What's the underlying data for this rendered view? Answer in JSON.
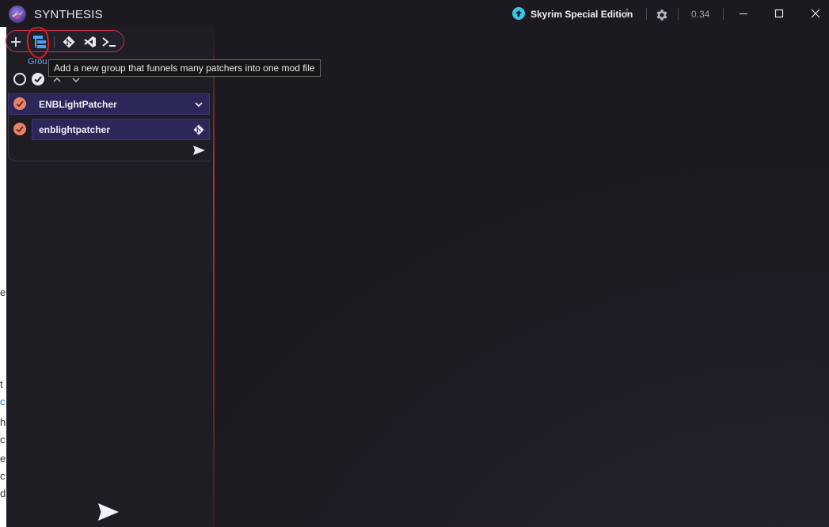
{
  "app": {
    "title": "SYNTHESIS"
  },
  "header": {
    "game_label": "Skyrim Special Edition",
    "version": "0.34",
    "icons": [
      "synthesis-logo-icon",
      "game-upload-icon",
      "info-icon",
      "gear-icon",
      "minimize-icon",
      "maximize-icon",
      "close-icon"
    ]
  },
  "toolbar": {
    "buttons": [
      "add-icon",
      "add-group-icon",
      "git-icon",
      "visual-studio-icon",
      "terminal-icon"
    ],
    "group_hint": "Grou",
    "tooltip": "Add a new group that funnels many patchers into one mod file"
  },
  "group": {
    "name": "ENBLightPatcher",
    "patchers": [
      {
        "name": "enblightpatcher"
      }
    ]
  },
  "background_window_fragments": [
    "e",
    "t",
    "c",
    "h",
    "c",
    "e",
    "c",
    "d"
  ],
  "colors": {
    "accent_red": "#c8324a",
    "row_bg": "#2c2759",
    "check_badge": "#e8836a",
    "game_icon": "#38c9e8",
    "link_blue": "#5fa7ff"
  }
}
